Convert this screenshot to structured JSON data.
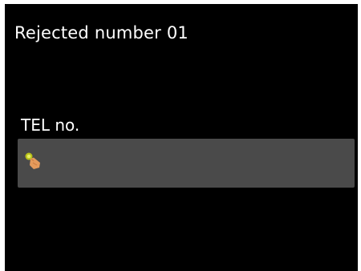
{
  "screen": {
    "title": "Rejected number 01",
    "field": {
      "label": "TEL no.",
      "value": "",
      "icon": "touch-hand-icon"
    }
  }
}
